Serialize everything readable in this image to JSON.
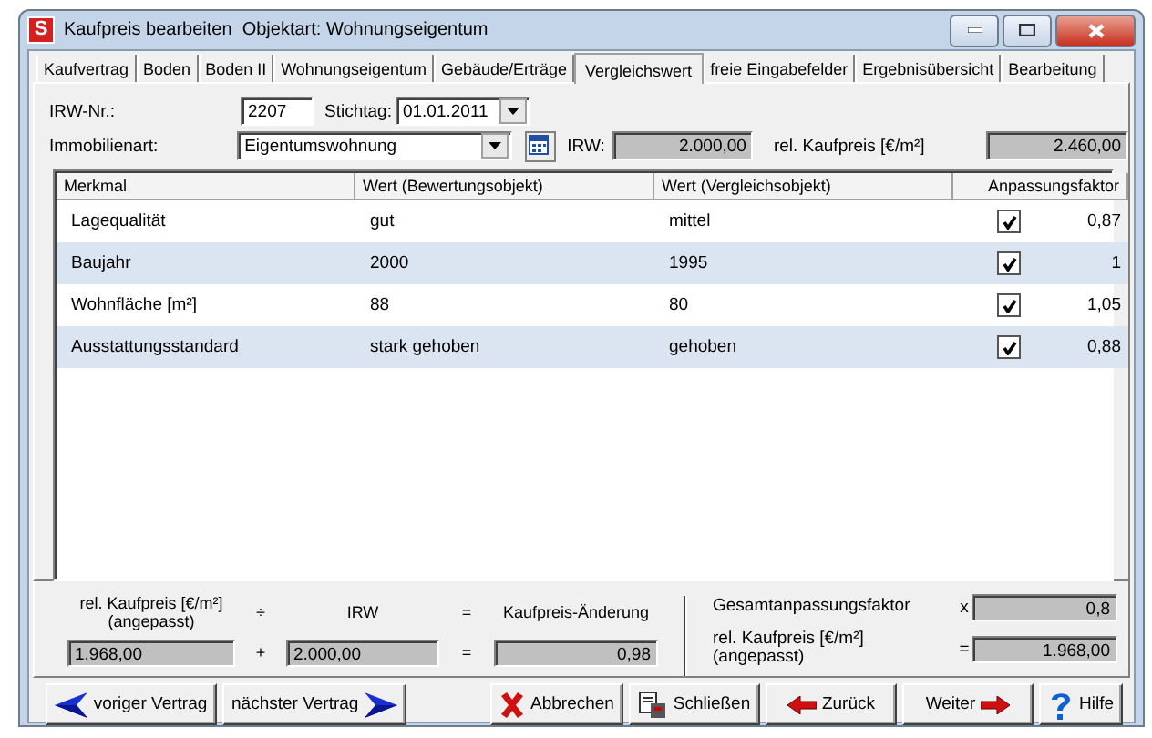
{
  "window": {
    "app_icon": "S",
    "title": "Kaufpreis bearbeiten  Objektart: Wohnungseigentum"
  },
  "tabs": [
    {
      "label": "Kaufvertrag",
      "selected": false
    },
    {
      "label": "Boden",
      "selected": false
    },
    {
      "label": "Boden II",
      "selected": false
    },
    {
      "label": "Wohnungseigentum",
      "selected": false
    },
    {
      "label": "Gebäude/Erträge",
      "selected": false
    },
    {
      "label": "Vergleichswert",
      "selected": true
    },
    {
      "label": "freie Eingabefelder",
      "selected": false
    },
    {
      "label": "Ergebnisübersicht",
      "selected": false
    },
    {
      "label": "Bearbeitung",
      "selected": false
    }
  ],
  "form": {
    "irw_nr": {
      "label": "IRW-Nr.:",
      "value": "2207"
    },
    "stichtag": {
      "label": "Stichtag:",
      "value": "01.01.2011"
    },
    "immobilienart": {
      "label": "Immobilienart:",
      "value": "Eigentumswohnung"
    },
    "irw": {
      "label": "IRW:",
      "value": "2.000,00"
    },
    "rel_kaufpreis": {
      "label": "rel. Kaufpreis [€/m²]",
      "value": "2.460,00"
    }
  },
  "table": {
    "columns": [
      "Merkmal",
      "Wert (Bewertungsobjekt)",
      "Wert (Vergleichsobjekt)",
      "Anpassungsfaktor"
    ],
    "rows": [
      {
        "merkmal": "Lagequalität",
        "bewertung": "gut",
        "vergleich": "mittel",
        "checked": true,
        "faktor": "0,87"
      },
      {
        "merkmal": "Baujahr",
        "bewertung": "2000",
        "vergleich": "1995",
        "checked": true,
        "faktor": "1"
      },
      {
        "merkmal": "Wohnfläche [m²]",
        "bewertung": "88",
        "vergleich": "80",
        "checked": true,
        "faktor": "1,05"
      },
      {
        "merkmal": "Ausstattungsstandard",
        "bewertung": "stark gehoben",
        "vergleich": "gehoben",
        "checked": true,
        "faktor": "0,88"
      }
    ]
  },
  "summary": {
    "headings": [
      "rel. Kaufpreis [€/m²]\n(angepasst)",
      "÷",
      "IRW",
      "=",
      "Kaufpreis-Änderung"
    ],
    "values": [
      "1.968,00",
      "+",
      "2.000,00",
      "=",
      "0,98"
    ],
    "gesamt": {
      "label": "Gesamtanpassungsfaktor",
      "operator": "x",
      "value": "0,8"
    },
    "angepasst": {
      "label": "rel. Kaufpreis [€/m²]\n(angepasst)",
      "operator": "=",
      "value": "1.968,00"
    }
  },
  "buttons": [
    {
      "label": "voriger Vertrag",
      "kind": "prev"
    },
    {
      "label": "nächster Vertrag",
      "kind": "next"
    },
    {
      "label": "Abbrechen",
      "kind": "cancel"
    },
    {
      "label": "Schließen",
      "kind": "close"
    },
    {
      "label": "Zurück",
      "kind": "back"
    },
    {
      "label": "Weiter",
      "kind": "forward"
    },
    {
      "label": "Hilfe",
      "kind": "help"
    }
  ]
}
